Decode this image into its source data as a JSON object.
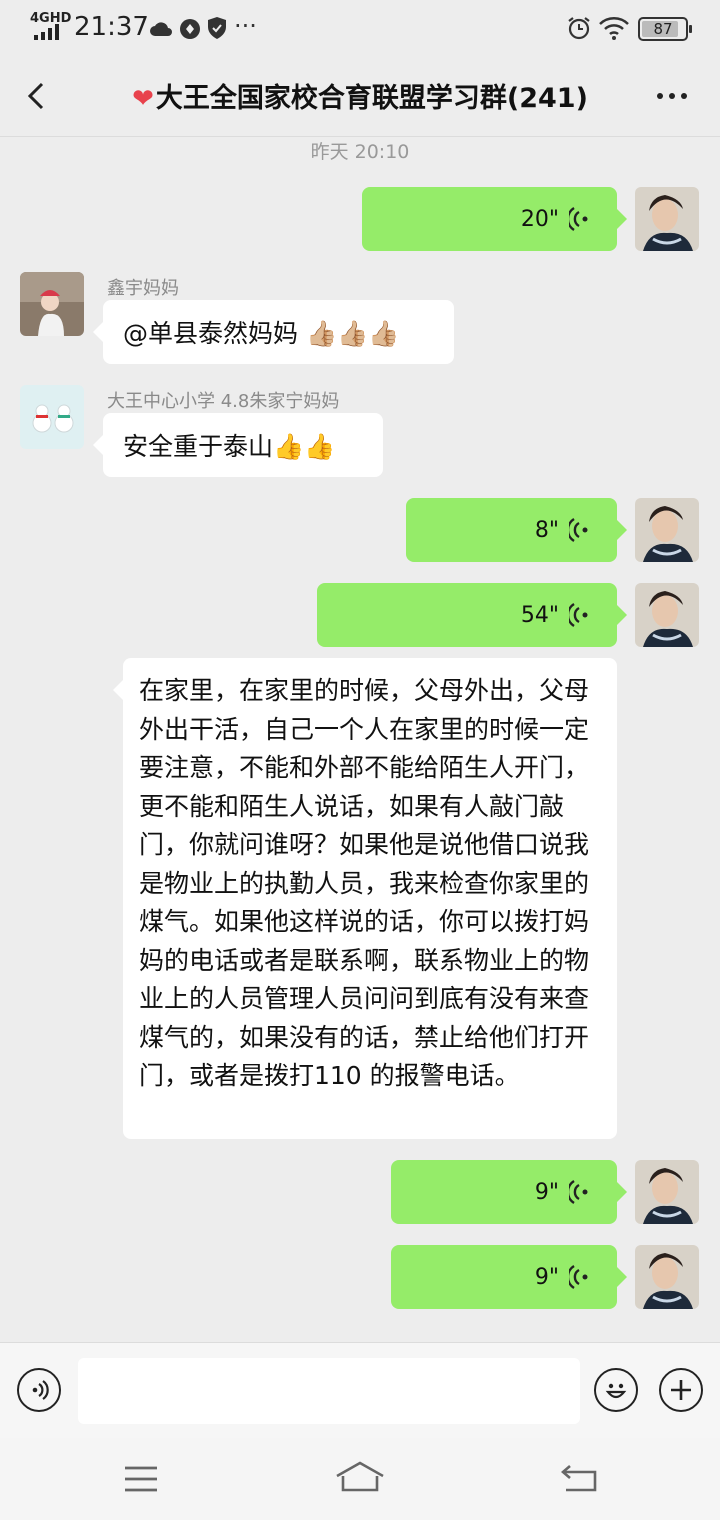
{
  "status_bar": {
    "network": "4GHD",
    "time": "21:37",
    "more": "···",
    "battery": "87"
  },
  "header": {
    "title": "大王全国家校合育联盟学习群(241)"
  },
  "chat": {
    "timestamp": "昨天 20:10",
    "messages": [
      {
        "type": "voice",
        "side": "right",
        "duration": "20\""
      },
      {
        "type": "text",
        "side": "left",
        "sender": "鑫宇妈妈",
        "text": "@单县泰然妈妈 👍🏼👍🏼👍🏼"
      },
      {
        "type": "text",
        "side": "left",
        "sender": "大王中心小学 4.8朱家宁妈妈",
        "text": "安全重于泰山👍👍"
      },
      {
        "type": "voice",
        "side": "right",
        "duration": "8\""
      },
      {
        "type": "voice",
        "side": "right",
        "duration": "54\""
      },
      {
        "type": "text",
        "side": "right",
        "text": "在家里，在家里的时候，父母外出，父母外出干活，自己一个人在家里的时候一定要注意，不能和外部不能给陌生人开门，更不能和陌生人说话，如果有人敲门敲门，你就问谁呀？如果他是说他借口说我是物业上的执勤人员，我来检查你家里的煤气。如果他这样说的话，你可以拨打妈妈的电话或者是联系啊，联系物业上的物业上的人员管理人员问问到底有没有来查煤气的，如果没有的话，禁止给他们打开门，或者是拨打110 的报警电话。"
      },
      {
        "type": "voice",
        "side": "right",
        "duration": "9\""
      },
      {
        "type": "voice",
        "side": "right",
        "duration": "9\""
      }
    ]
  },
  "colors": {
    "sent_bubble": "#95ec69",
    "received_bubble": "#ffffff",
    "background": "#ededed"
  }
}
